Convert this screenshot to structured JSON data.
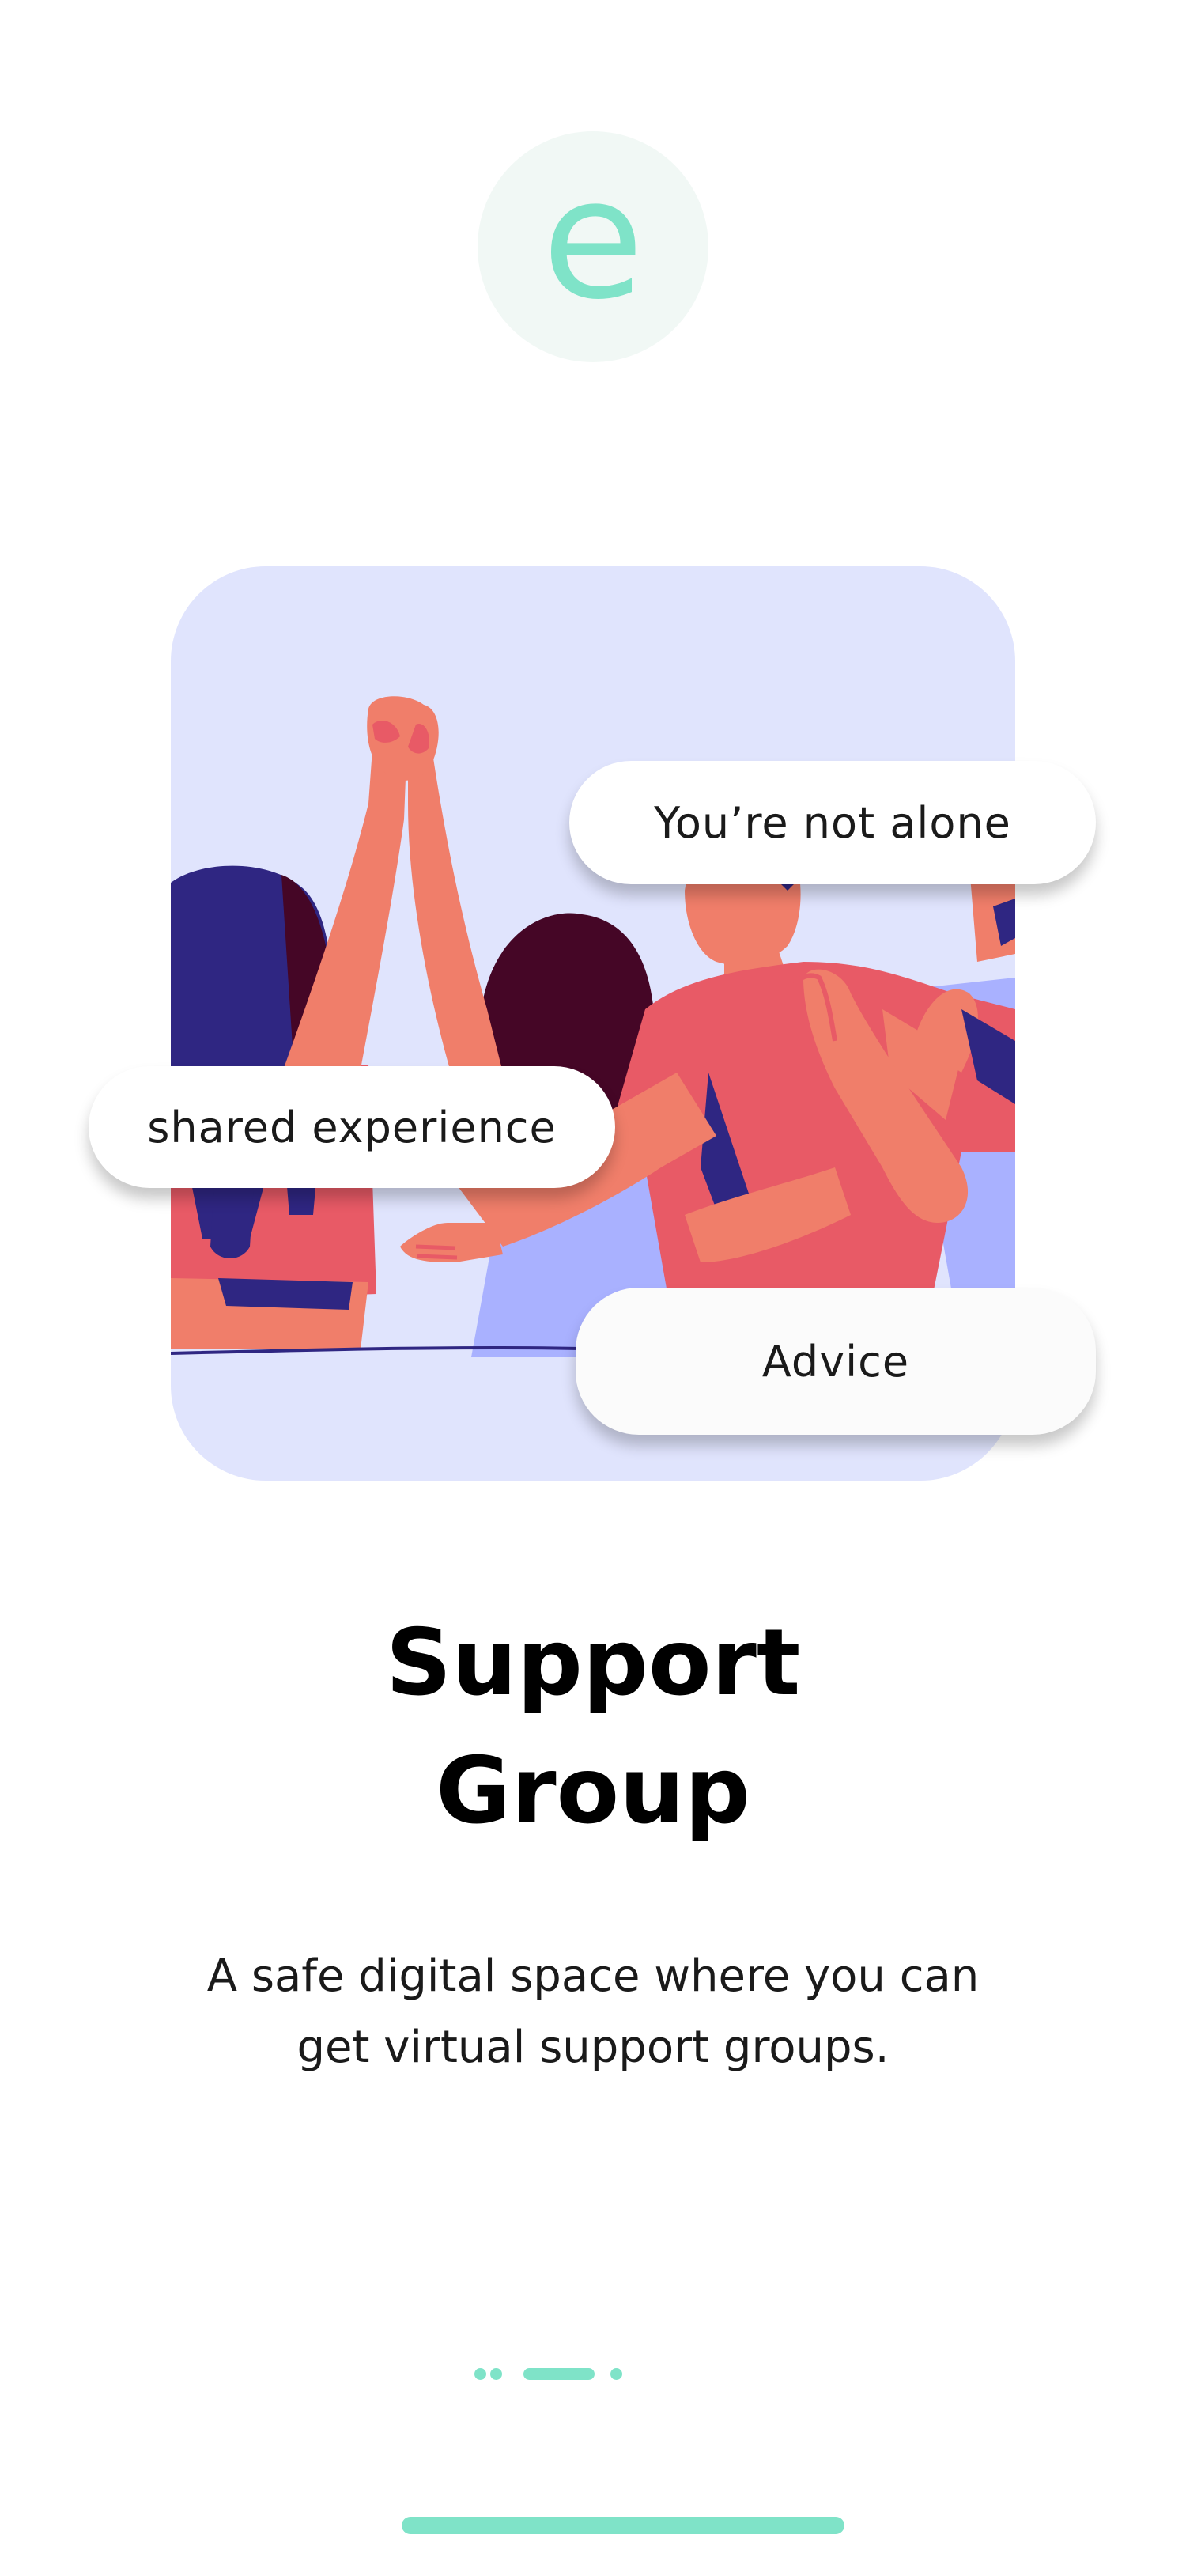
{
  "logo": {
    "letter": "e",
    "icon": "app-logo-letter-e"
  },
  "illustration": {
    "icon": "support-group-people-illustration",
    "tags": [
      "You’re not alone",
      "shared experience",
      "Advice"
    ]
  },
  "title_lines": [
    "Support",
    "Group"
  ],
  "description_lines": [
    "A safe digital space where you can",
    "get virtual support groups."
  ],
  "pagination": {
    "total": 4,
    "active": 2
  },
  "colors": {
    "accent": "#7fe3c8",
    "logo_circle": "#f1f8f5",
    "card_bg": "#e0e4fd",
    "coral": "#f07e6a",
    "red_shirt": "#e85a66",
    "navy": "#2f2682",
    "maroon": "#450626",
    "lavender": "#a9b1ff"
  }
}
